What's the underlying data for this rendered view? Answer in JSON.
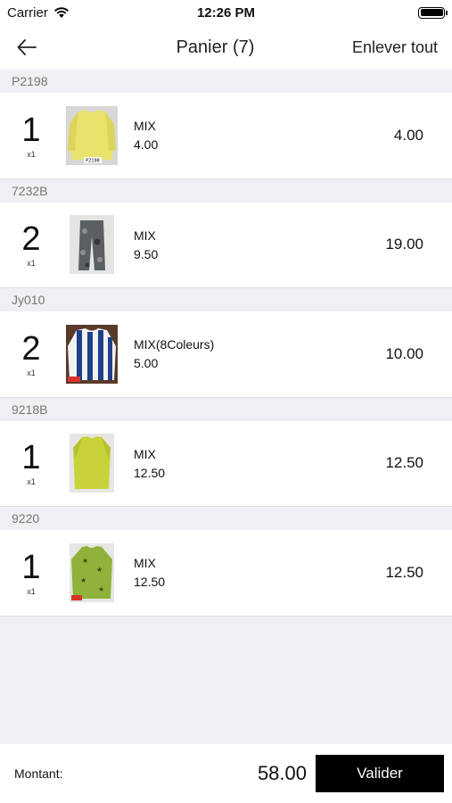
{
  "status_bar": {
    "carrier": "Carrier",
    "time": "12:26 PM"
  },
  "nav": {
    "title": "Panier (7)",
    "action": "Enlever tout"
  },
  "sections": [
    {
      "header": "P2198",
      "qty": "1",
      "mult": "x1",
      "name": "MIX",
      "price": "4.00",
      "total": "4.00",
      "thumb_color": "#e8e06a",
      "thumb_label": "P2198"
    },
    {
      "header": "7232B",
      "qty": "2",
      "mult": "x1",
      "name": "MIX",
      "price": "9.50",
      "total": "19.00",
      "thumb_color": "#5a5f63",
      "thumb_label": ""
    },
    {
      "header": "Jy010",
      "qty": "2",
      "mult": "x1",
      "name": "MIX(8Coleurs)",
      "price": "5.00",
      "total": "10.00",
      "thumb_color": "#1f3f88",
      "thumb_label": ""
    },
    {
      "header": "9218B",
      "qty": "1",
      "mult": "x1",
      "name": "MIX",
      "price": "12.50",
      "total": "12.50",
      "thumb_color": "#c8d23a",
      "thumb_label": ""
    },
    {
      "header": "9220",
      "qty": "1",
      "mult": "x1",
      "name": "MIX",
      "price": "12.50",
      "total": "12.50",
      "thumb_color": "#8fb23a",
      "thumb_label": ""
    }
  ],
  "footer": {
    "amount_label": "Montant:",
    "amount_value": "58.00",
    "validate_label": "Valider"
  }
}
